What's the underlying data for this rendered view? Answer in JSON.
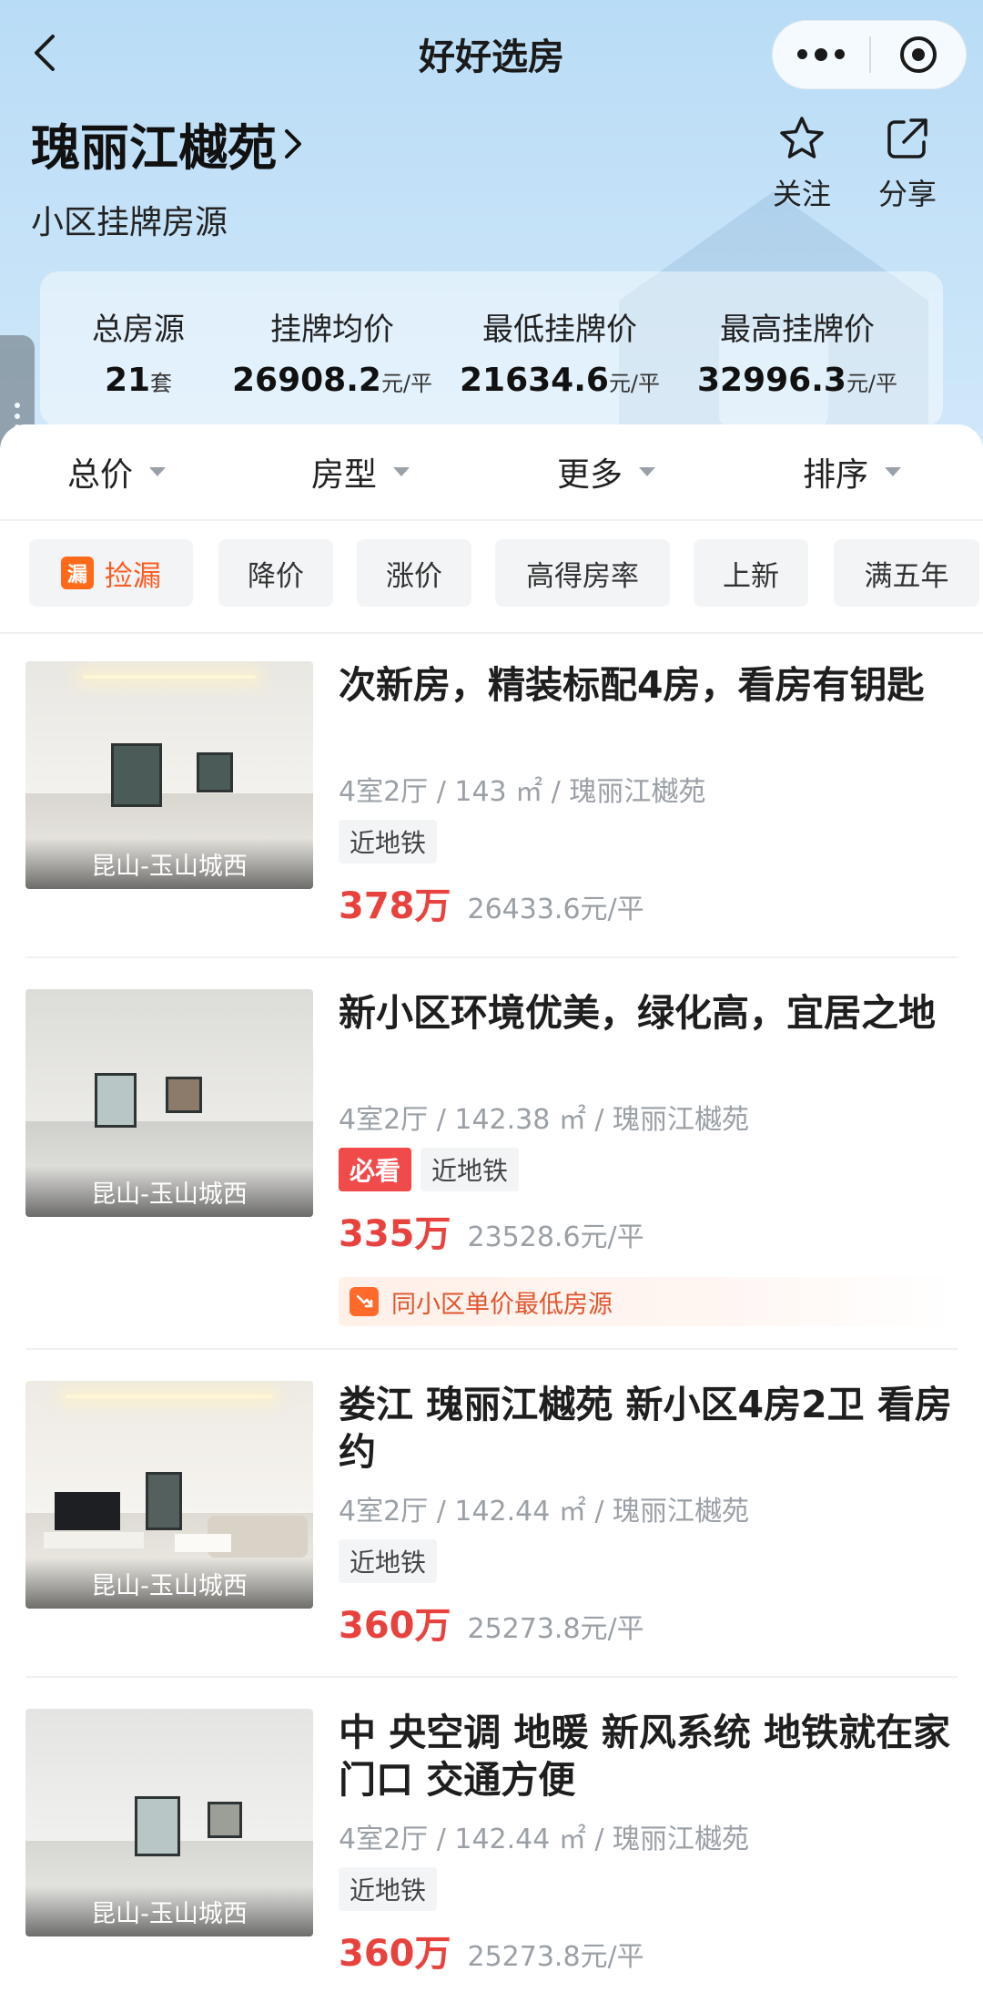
{
  "nav": {
    "title": "好好选房"
  },
  "community": {
    "name": "瑰丽江樾苑",
    "subtitle": "小区挂牌房源",
    "follow_label": "关注",
    "share_label": "分享"
  },
  "stats": [
    {
      "label": "总房源",
      "value": "21",
      "unit": "套"
    },
    {
      "label": "挂牌均价",
      "value": "26908.2",
      "unit": "元/平"
    },
    {
      "label": "最低挂牌价",
      "value": "21634.6",
      "unit": "元/平"
    },
    {
      "label": "最高挂牌价",
      "value": "32996.3",
      "unit": "元/平"
    }
  ],
  "filters": [
    "总价",
    "房型",
    "更多",
    "排序"
  ],
  "chips": [
    {
      "icon": "漏",
      "label": "捡漏"
    },
    {
      "label": "降价"
    },
    {
      "label": "涨价"
    },
    {
      "label": "高得房率"
    },
    {
      "label": "上新"
    },
    {
      "label": "满五年"
    }
  ],
  "listings": [
    {
      "title": "次新房，精装标配4房，看房有钥匙",
      "meta": "4室2厅 / 143 ㎡ / 瑰丽江樾苑",
      "tags": [
        "近地铁"
      ],
      "price": "378万",
      "unit_price": "26433.6元/平",
      "location": "昆山-玉山城西"
    },
    {
      "title": "新小区环境优美，绿化高，宜居之地",
      "meta": "4室2厅 / 142.38 ㎡ / 瑰丽江樾苑",
      "must_tag": "必看",
      "tags": [
        "近地铁"
      ],
      "price": "335万",
      "unit_price": "23528.6元/平",
      "hint": "同小区单价最低房源",
      "location": "昆山-玉山城西"
    },
    {
      "title": "娄江 瑰丽江樾苑 新小区4房2卫 看房约",
      "meta": "4室2厅 / 142.44 ㎡ / 瑰丽江樾苑",
      "tags": [
        "近地铁"
      ],
      "price": "360万",
      "unit_price": "25273.8元/平",
      "location": "昆山-玉山城西"
    },
    {
      "title": "中 央空调 地暖 新风系统 地铁就在家门口 交通方便",
      "meta": "4室2厅 / 142.44 ㎡ / 瑰丽江樾苑",
      "tags": [
        "近地铁"
      ],
      "price": "360万",
      "unit_price": "25273.8元/平",
      "location": "昆山-玉山城西"
    }
  ],
  "colors": {
    "accent_red": "#e8423f",
    "accent_orange": "#ff6a1a",
    "hero_blue": "#c7e3f8"
  }
}
